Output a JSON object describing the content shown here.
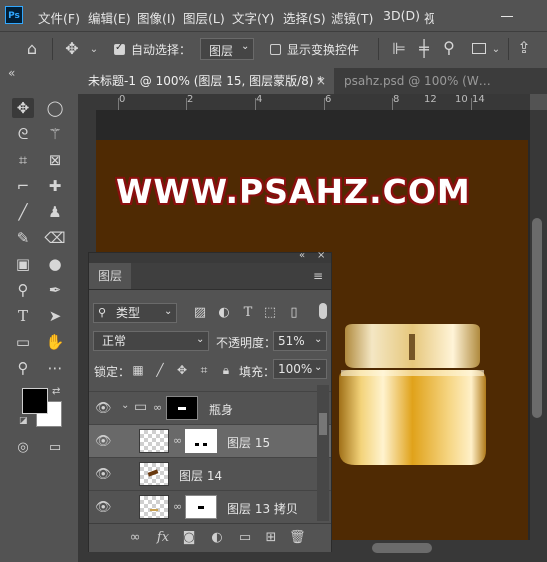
{
  "app": {
    "logo": "Ps"
  },
  "menu": [
    "文件(F)",
    "编辑(E)",
    "图像(I)",
    "图层(L)",
    "文字(Y)",
    "选择(S)",
    "滤镜(T)",
    "3D(D)",
    "视"
  ],
  "options": {
    "auto_select_label": "自动选择：",
    "auto_select_checked": true,
    "auto_select_target": "图层",
    "show_transform_label": "显示变换控件",
    "show_transform_checked": false
  },
  "tabs": [
    {
      "label": "未标题-1 @ 100% (图层 15, 图层蒙版/8) *",
      "active": true,
      "close": "×"
    },
    {
      "label": "psahz.psd @ 100% (W…",
      "active": false
    }
  ],
  "ruler": {
    "top_ticks": [
      "0",
      "2",
      "4",
      "6",
      "8",
      "10",
      "12",
      "14"
    ]
  },
  "canvas": {
    "watermark": "WWW.PSAHZ.COM",
    "background": "#4f2a03"
  },
  "colors": {
    "foreground": "#000000",
    "background": "#ffffff"
  },
  "layers_panel": {
    "collapse_icon": "«",
    "title": "图层",
    "filter_kind": "类型",
    "blend_mode": "正常",
    "opacity_label": "不透明度：",
    "opacity_value": "51%",
    "lock_label": "锁定：",
    "fill_label": "填充：",
    "fill_value": "100%",
    "layers": [
      {
        "name": "瓶身",
        "type": "group",
        "visible": true,
        "selected": false
      },
      {
        "name": "图层 15",
        "type": "layer-with-mask",
        "visible": true,
        "selected": true
      },
      {
        "name": "图层 14",
        "type": "layer",
        "visible": true,
        "selected": false
      },
      {
        "name": "图层 13 拷贝",
        "type": "layer-with-mask",
        "visible": true,
        "selected": false
      }
    ]
  }
}
